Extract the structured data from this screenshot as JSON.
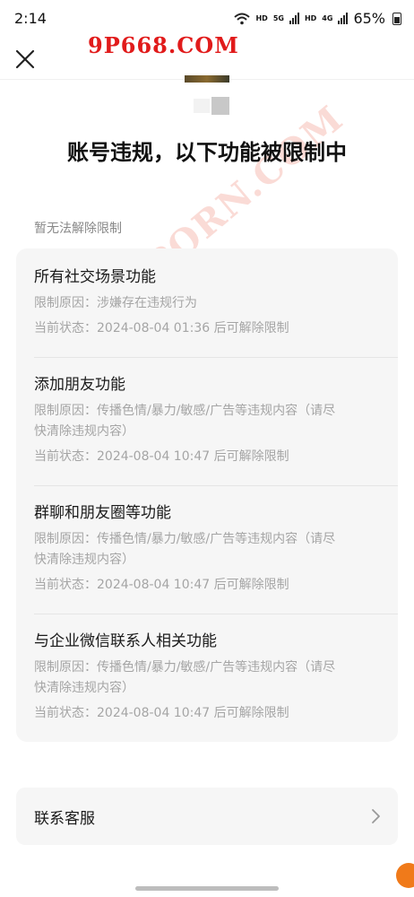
{
  "status_bar": {
    "time": "2:14",
    "hd1": "HD",
    "net1": "5G",
    "hd2": "HD",
    "net2": "4G",
    "battery": "65%"
  },
  "watermark": {
    "top": "9P668.COM",
    "diagonal": "9PORN.COM"
  },
  "page": {
    "title": "账号违规，以下功能被限制中",
    "section_label": "暂无法解除限制"
  },
  "restrictions": [
    {
      "title": "所有社交场景功能",
      "reason": "限制原因：涉嫌存在违规行为",
      "status": "当前状态：2024-08-04 01:36 后可解除限制"
    },
    {
      "title": "添加朋友功能",
      "reason_line1": "限制原因：传播色情/暴力/敏感/广告等违规内容（请尽",
      "reason_line2": "快清除违规内容）",
      "status": "当前状态：2024-08-04 10:47 后可解除限制"
    },
    {
      "title": "群聊和朋友圈等功能",
      "reason_line1": "限制原因：传播色情/暴力/敏感/广告等违规内容（请尽",
      "reason_line2": "快清除违规内容）",
      "status": "当前状态：2024-08-04 10:47 后可解除限制"
    },
    {
      "title": "与企业微信联系人相关功能",
      "reason_line1": "限制原因：传播色情/暴力/敏感/广告等违规内容（请尽",
      "reason_line2": "快清除违规内容）",
      "status": "当前状态：2024-08-04 10:47 后可解除限制"
    }
  ],
  "contact": {
    "label": "联系客服"
  },
  "icons": {
    "close": "close-icon",
    "chevron": "chevron-right-icon",
    "wifi": "wifi-icon",
    "battery": "battery-icon"
  }
}
